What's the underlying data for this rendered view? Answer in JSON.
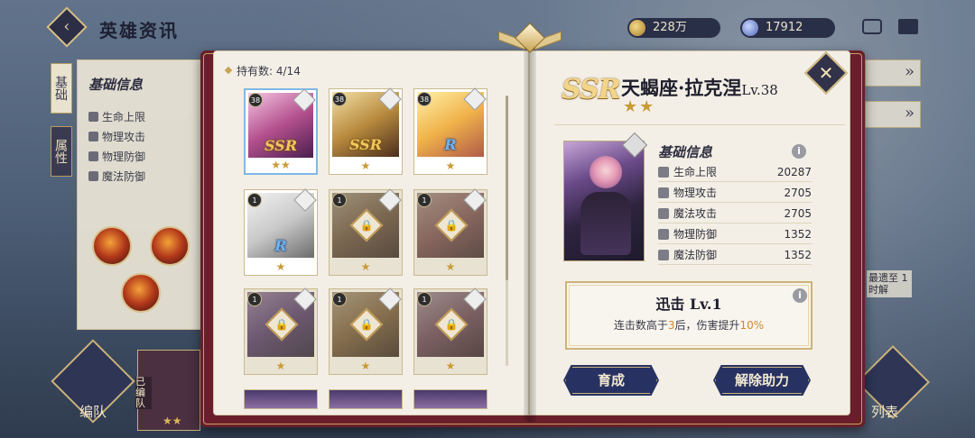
{
  "header": {
    "title": "英雄资讯",
    "back_icon": "diamond-back-icon",
    "currencies": [
      {
        "icon": "gold-coin-icon",
        "value": "228万"
      },
      {
        "icon": "gem-icon",
        "value": "17912"
      }
    ]
  },
  "background_panel": {
    "tabs": [
      "基础",
      "属性"
    ],
    "title": "基础信息",
    "stats": [
      "生命上限",
      "物理攻击",
      "物理防御",
      "魔法防御"
    ],
    "formation_label": "编队",
    "list_label": "列表",
    "assigned_label": "已编队",
    "hint": "最遗至 1时解"
  },
  "book": {
    "owned_label": "持有数:",
    "owned_value": "4/14",
    "cards": [
      {
        "level": "38",
        "rarity": "SSR",
        "stars": "★★",
        "locked": false,
        "selected": true
      },
      {
        "level": "38",
        "rarity": "SSR",
        "stars": "★",
        "locked": false,
        "selected": false
      },
      {
        "level": "38",
        "rarity": "R",
        "stars": "★",
        "locked": false,
        "selected": false
      },
      {
        "level": "1",
        "rarity": "R",
        "stars": "★",
        "locked": false,
        "selected": false
      },
      {
        "level": "1",
        "rarity": "",
        "stars": "★",
        "locked": true,
        "selected": false
      },
      {
        "level": "1",
        "rarity": "",
        "stars": "★",
        "locked": true,
        "selected": false
      },
      {
        "level": "1",
        "rarity": "",
        "stars": "★",
        "locked": true,
        "selected": false
      },
      {
        "level": "1",
        "rarity": "",
        "stars": "★",
        "locked": true,
        "selected": false
      },
      {
        "level": "1",
        "rarity": "",
        "stars": "★",
        "locked": true,
        "selected": false
      }
    ]
  },
  "hero": {
    "rarity": "SSR",
    "name": "天蝎座·拉克涅",
    "level": "Lv.38",
    "stars": "★★",
    "info_title": "基础信息",
    "stats": [
      {
        "icon": "heart-icon",
        "label": "生命上限",
        "value": "20287"
      },
      {
        "icon": "sword-icon",
        "label": "物理攻击",
        "value": "2705"
      },
      {
        "icon": "wand-icon",
        "label": "魔法攻击",
        "value": "2705"
      },
      {
        "icon": "shield-icon",
        "label": "物理防御",
        "value": "1352"
      },
      {
        "icon": "magic-shield-icon",
        "label": "魔法防御",
        "value": "1352"
      }
    ],
    "skill": {
      "name": "迅击 Lv.1",
      "desc_prefix": "连击数高于",
      "desc_num": "3",
      "desc_mid": "后，伤害提升",
      "desc_pct": "10%"
    },
    "buttons": {
      "develop": "育成",
      "release": "解除助力"
    }
  },
  "colors": {
    "accent_gold": "#c99a37",
    "button_navy": "#283262",
    "highlight_orange": "#d1892b",
    "book_cover": "#6a1e2b"
  }
}
